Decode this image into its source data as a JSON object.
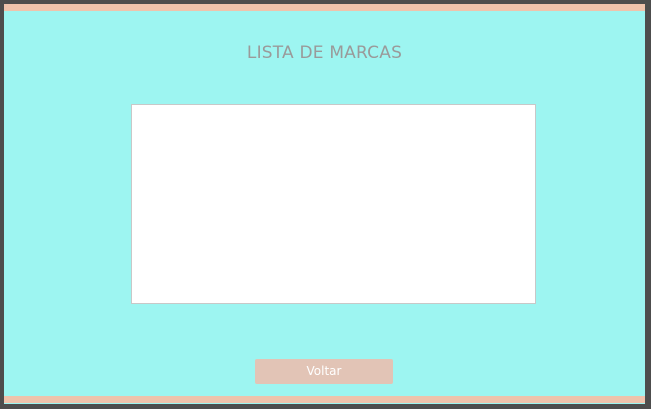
{
  "page": {
    "title": "LISTA DE MARCAS"
  },
  "list": {
    "items": []
  },
  "actions": {
    "back_label": "Voltar"
  },
  "colors": {
    "background": "#9df5f1",
    "frame": "#4d4d4d",
    "accent_stripe": "#efc3ac",
    "button": "#e2c4b6",
    "title_text": "#9a9a9a"
  }
}
